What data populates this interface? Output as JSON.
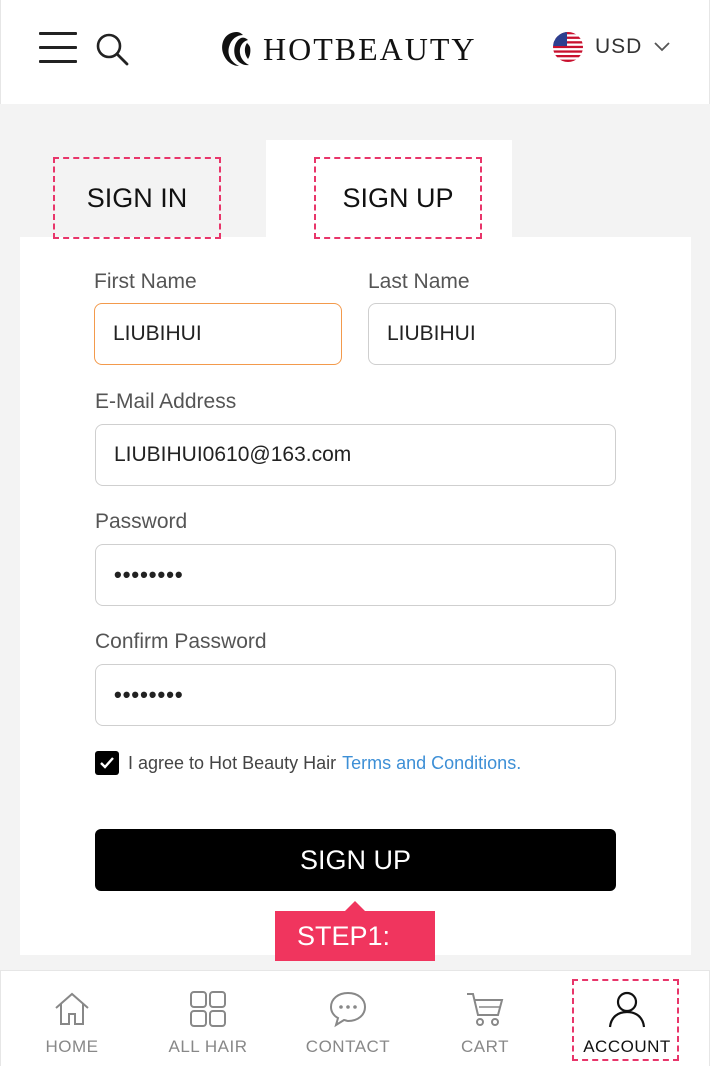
{
  "header": {
    "brand": "HOTBEAUTY",
    "currency": "USD"
  },
  "tabs": {
    "sign_in": "SIGN IN",
    "sign_up": "SIGN UP"
  },
  "form": {
    "first_name_label": "First Name",
    "first_name_value": "LIUBIHUI",
    "last_name_label": "Last Name",
    "last_name_value": "LIUBIHUI",
    "email_label": "E-Mail Address",
    "email_value": "LIUBIHUI0610@163.com",
    "password_label": "Password",
    "password_value": "••••••••",
    "confirm_label": "Confirm Password",
    "confirm_value": "••••••••",
    "agree_text": "I agree to Hot Beauty Hair",
    "terms_link": "Terms and Conditions.",
    "agree_checked": true,
    "submit_label": "SIGN UP"
  },
  "annotation": {
    "step": "STEP1:"
  },
  "bottom_nav": {
    "items": [
      {
        "label": "HOME",
        "icon": "home-icon"
      },
      {
        "label": "ALL HAIR",
        "icon": "grid-icon"
      },
      {
        "label": "CONTACT",
        "icon": "chat-icon"
      },
      {
        "label": "CART",
        "icon": "cart-icon"
      },
      {
        "label": "ACCOUNT",
        "icon": "user-icon"
      }
    ],
    "active": "ACCOUNT"
  },
  "colors": {
    "accent_dashed": "#e8356a",
    "step_badge": "#f0355e",
    "focus_border": "#f39a4c",
    "link": "#3d8fd6"
  }
}
